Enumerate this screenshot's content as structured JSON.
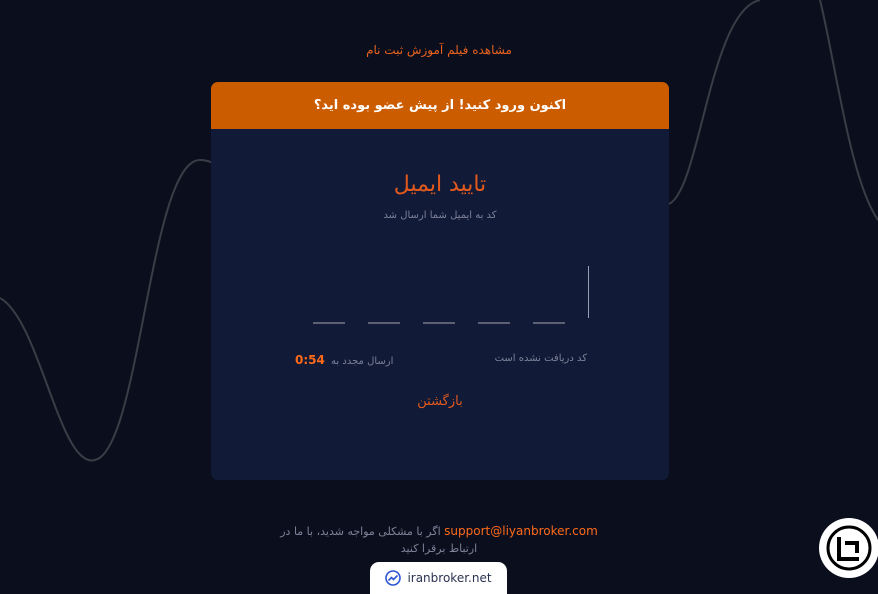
{
  "top_link": "مشاهده فیلم آموزش ثبت نام",
  "card": {
    "header": "اکنون ورود کنید! از پیش عضو بوده اید؟",
    "title": "تایید ایمیل",
    "subtitle": "کد به ایمیل شما ارسال شد",
    "resend_label": "ارسال مجدد به",
    "timer": "0:54",
    "not_received": "کد دریافت نشده است",
    "back": "بازگشتن"
  },
  "footer": {
    "line1": "اگر با مشکلی مواجه شدید، با ما در",
    "email": "support@liyanbroker.com",
    "line2": "ارتباط برقرا کنید",
    "brand": "iranbroker.net"
  },
  "colors": {
    "accent": "#cc5c00",
    "background": "#0b0f1d",
    "card": "#111a36"
  },
  "icons": {
    "brand": "trend-chart-icon",
    "chat": "support-chat-icon"
  }
}
